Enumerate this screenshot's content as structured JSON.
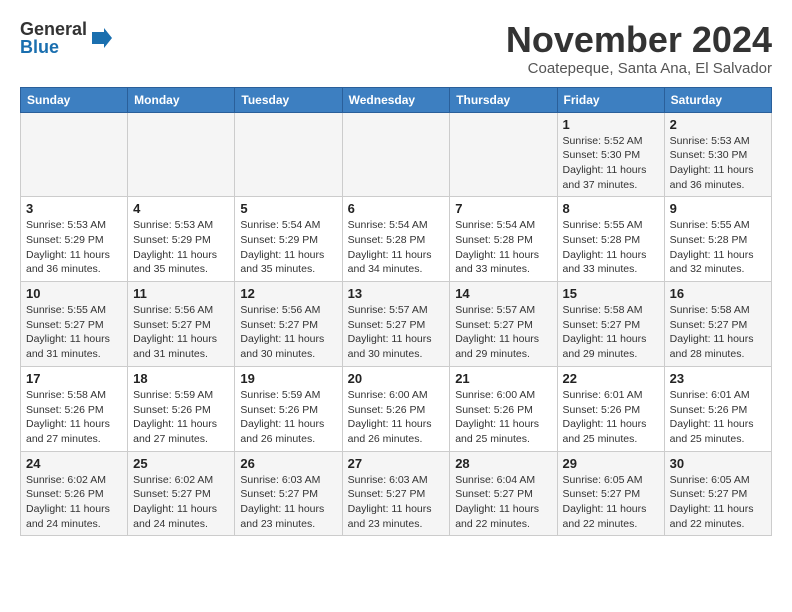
{
  "header": {
    "logo_line1": "General",
    "logo_line2": "Blue",
    "month_title": "November 2024",
    "location": "Coatepeque, Santa Ana, El Salvador"
  },
  "weekdays": [
    "Sunday",
    "Monday",
    "Tuesday",
    "Wednesday",
    "Thursday",
    "Friday",
    "Saturday"
  ],
  "weeks": [
    [
      {
        "day": "",
        "info": ""
      },
      {
        "day": "",
        "info": ""
      },
      {
        "day": "",
        "info": ""
      },
      {
        "day": "",
        "info": ""
      },
      {
        "day": "",
        "info": ""
      },
      {
        "day": "1",
        "info": "Sunrise: 5:52 AM\nSunset: 5:30 PM\nDaylight: 11 hours and 37 minutes."
      },
      {
        "day": "2",
        "info": "Sunrise: 5:53 AM\nSunset: 5:30 PM\nDaylight: 11 hours and 36 minutes."
      }
    ],
    [
      {
        "day": "3",
        "info": "Sunrise: 5:53 AM\nSunset: 5:29 PM\nDaylight: 11 hours and 36 minutes."
      },
      {
        "day": "4",
        "info": "Sunrise: 5:53 AM\nSunset: 5:29 PM\nDaylight: 11 hours and 35 minutes."
      },
      {
        "day": "5",
        "info": "Sunrise: 5:54 AM\nSunset: 5:29 PM\nDaylight: 11 hours and 35 minutes."
      },
      {
        "day": "6",
        "info": "Sunrise: 5:54 AM\nSunset: 5:28 PM\nDaylight: 11 hours and 34 minutes."
      },
      {
        "day": "7",
        "info": "Sunrise: 5:54 AM\nSunset: 5:28 PM\nDaylight: 11 hours and 33 minutes."
      },
      {
        "day": "8",
        "info": "Sunrise: 5:55 AM\nSunset: 5:28 PM\nDaylight: 11 hours and 33 minutes."
      },
      {
        "day": "9",
        "info": "Sunrise: 5:55 AM\nSunset: 5:28 PM\nDaylight: 11 hours and 32 minutes."
      }
    ],
    [
      {
        "day": "10",
        "info": "Sunrise: 5:55 AM\nSunset: 5:27 PM\nDaylight: 11 hours and 31 minutes."
      },
      {
        "day": "11",
        "info": "Sunrise: 5:56 AM\nSunset: 5:27 PM\nDaylight: 11 hours and 31 minutes."
      },
      {
        "day": "12",
        "info": "Sunrise: 5:56 AM\nSunset: 5:27 PM\nDaylight: 11 hours and 30 minutes."
      },
      {
        "day": "13",
        "info": "Sunrise: 5:57 AM\nSunset: 5:27 PM\nDaylight: 11 hours and 30 minutes."
      },
      {
        "day": "14",
        "info": "Sunrise: 5:57 AM\nSunset: 5:27 PM\nDaylight: 11 hours and 29 minutes."
      },
      {
        "day": "15",
        "info": "Sunrise: 5:58 AM\nSunset: 5:27 PM\nDaylight: 11 hours and 29 minutes."
      },
      {
        "day": "16",
        "info": "Sunrise: 5:58 AM\nSunset: 5:27 PM\nDaylight: 11 hours and 28 minutes."
      }
    ],
    [
      {
        "day": "17",
        "info": "Sunrise: 5:58 AM\nSunset: 5:26 PM\nDaylight: 11 hours and 27 minutes."
      },
      {
        "day": "18",
        "info": "Sunrise: 5:59 AM\nSunset: 5:26 PM\nDaylight: 11 hours and 27 minutes."
      },
      {
        "day": "19",
        "info": "Sunrise: 5:59 AM\nSunset: 5:26 PM\nDaylight: 11 hours and 26 minutes."
      },
      {
        "day": "20",
        "info": "Sunrise: 6:00 AM\nSunset: 5:26 PM\nDaylight: 11 hours and 26 minutes."
      },
      {
        "day": "21",
        "info": "Sunrise: 6:00 AM\nSunset: 5:26 PM\nDaylight: 11 hours and 25 minutes."
      },
      {
        "day": "22",
        "info": "Sunrise: 6:01 AM\nSunset: 5:26 PM\nDaylight: 11 hours and 25 minutes."
      },
      {
        "day": "23",
        "info": "Sunrise: 6:01 AM\nSunset: 5:26 PM\nDaylight: 11 hours and 25 minutes."
      }
    ],
    [
      {
        "day": "24",
        "info": "Sunrise: 6:02 AM\nSunset: 5:26 PM\nDaylight: 11 hours and 24 minutes."
      },
      {
        "day": "25",
        "info": "Sunrise: 6:02 AM\nSunset: 5:27 PM\nDaylight: 11 hours and 24 minutes."
      },
      {
        "day": "26",
        "info": "Sunrise: 6:03 AM\nSunset: 5:27 PM\nDaylight: 11 hours and 23 minutes."
      },
      {
        "day": "27",
        "info": "Sunrise: 6:03 AM\nSunset: 5:27 PM\nDaylight: 11 hours and 23 minutes."
      },
      {
        "day": "28",
        "info": "Sunrise: 6:04 AM\nSunset: 5:27 PM\nDaylight: 11 hours and 22 minutes."
      },
      {
        "day": "29",
        "info": "Sunrise: 6:05 AM\nSunset: 5:27 PM\nDaylight: 11 hours and 22 minutes."
      },
      {
        "day": "30",
        "info": "Sunrise: 6:05 AM\nSunset: 5:27 PM\nDaylight: 11 hours and 22 minutes."
      }
    ]
  ]
}
